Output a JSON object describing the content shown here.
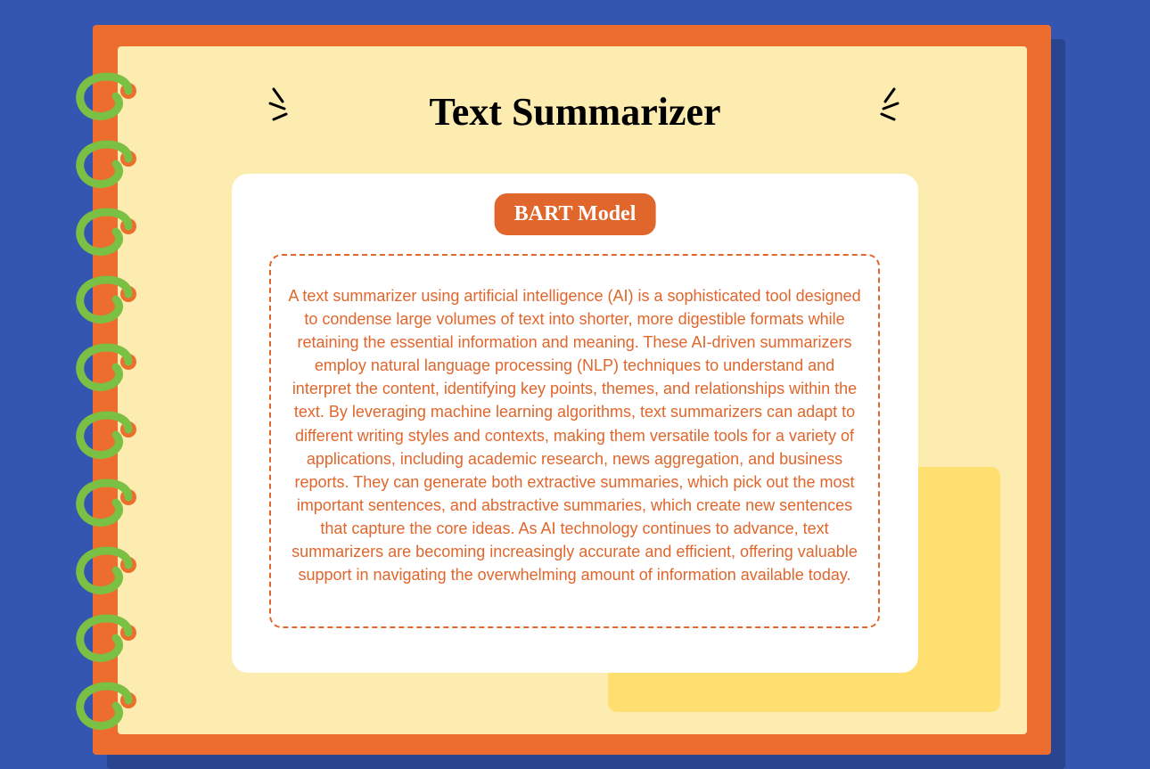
{
  "title": "Text Summarizer",
  "badge": "BART Model",
  "body": "A text summarizer using artificial intelligence (AI) is a sophisticated tool designed to condense large volumes of text into shorter, more digestible formats while retaining the essential information and meaning. These AI-driven summarizers employ natural language processing (NLP) techniques to understand and interpret the content, identifying key points, themes, and relationships within the text. By leveraging machine learning algorithms, text summarizers can adapt to different writing styles and contexts, making them versatile tools for a variety of applications, including academic research, news aggregation, and business reports. They can generate both extractive summaries, which pick out the most important sentences, and abstractive summaries, which create new sentences that capture the core ideas. As AI technology continues to advance, text summarizers are becoming increasingly accurate and efficient, offering valuable support in navigating the overwhelming amount of information available today."
}
